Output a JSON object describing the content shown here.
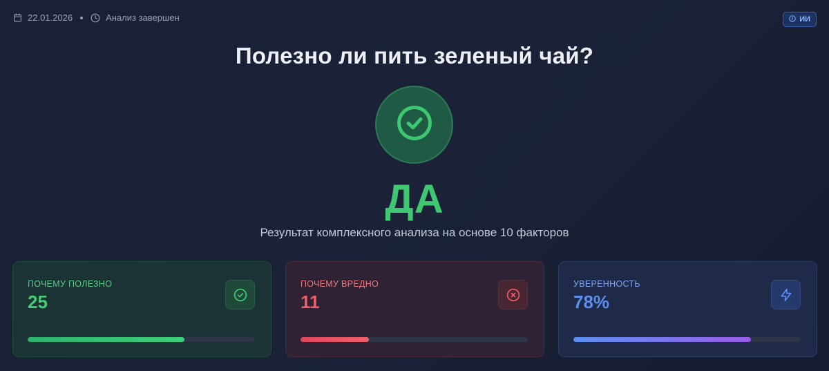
{
  "header": {
    "date": "22.01.2026",
    "status": "Анализ завершен",
    "badge": "ИИ"
  },
  "title": "Полезно ли пить зеленый чай?",
  "verdict": {
    "icon": "check-circle-icon",
    "label": "ДА",
    "color": "#3fc872"
  },
  "subtitle": "Результат комплексного анализа на основе 10 факторов",
  "cards": {
    "good": {
      "label": "ПОЧЕМУ ПОЛЕЗНО",
      "value": "25",
      "icon": "check-circle-icon",
      "progress": 0.69,
      "color": "#45cc77"
    },
    "bad": {
      "label": "ПОЧЕМУ ВРЕДНО",
      "value": "11",
      "icon": "x-circle-icon",
      "progress": 0.3,
      "color": "#ef5f6b"
    },
    "confidence": {
      "label": "УВЕРЕННОСТЬ",
      "value": "78%",
      "icon": "lightning-icon",
      "progress": 0.78,
      "color": "#5b8ff0"
    }
  }
}
